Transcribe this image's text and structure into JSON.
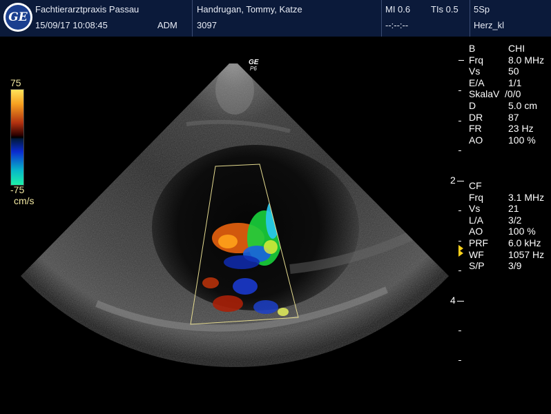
{
  "header": {
    "clinic": "Fachtierarztpraxis Passau",
    "datetime": "15/09/17 10:08:45",
    "operator": "ADM",
    "patient": "Handrugan, Tommy, Katze",
    "patient_id": "3097",
    "mi": "MI 0.6",
    "tis": "TIs 0.5",
    "time_placeholder": "--:--:--",
    "probe": "5Sp",
    "preset": "Herz_kl"
  },
  "logo_icon": "ge-logo-icon",
  "probe_marker": {
    "brand": "GE",
    "code": "P6"
  },
  "color_scale": {
    "max": "75",
    "min": "-75",
    "unit": "cm/s"
  },
  "b_mode": {
    "title": "B",
    "title_value": "CHI",
    "rows": [
      {
        "key": "Frq",
        "value": "8.0 MHz"
      },
      {
        "key": "Vs",
        "value": "50"
      },
      {
        "key": "E/A",
        "value": "1/1"
      },
      {
        "key": "SkalaV",
        "value": "/0/0"
      },
      {
        "key": "D",
        "value": "5.0 cm"
      },
      {
        "key": "DR",
        "value": "87"
      },
      {
        "key": "FR",
        "value": "23 Hz"
      },
      {
        "key": "AO",
        "value": "100 %"
      }
    ]
  },
  "cf_mode": {
    "title": "CF",
    "rows": [
      {
        "key": "Frq",
        "value": "3.1 MHz"
      },
      {
        "key": "Vs",
        "value": "21"
      },
      {
        "key": "L/A",
        "value": "3/2"
      },
      {
        "key": "AO",
        "value": "100 %"
      },
      {
        "key": "PRF",
        "value": "6.0 kHz"
      },
      {
        "key": "WF",
        "value": "1057 Hz"
      },
      {
        "key": "S/P",
        "value": "3/9"
      }
    ]
  },
  "depth_scale": {
    "mark_2": "2",
    "mark_4": "4"
  }
}
